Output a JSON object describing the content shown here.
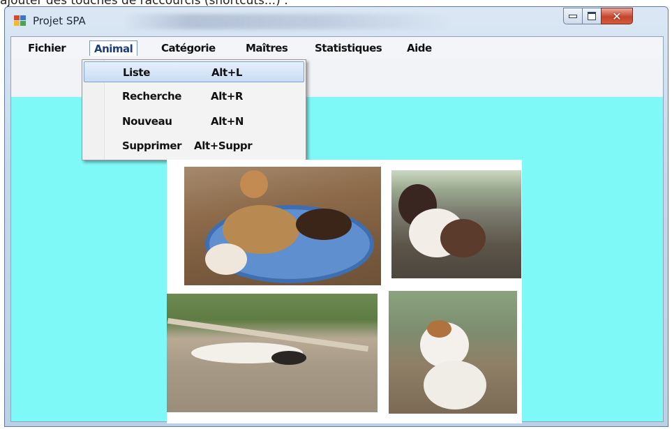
{
  "doc_text": "ajouter des touches de raccourcis (shortcuts...) :",
  "window": {
    "title": "Projet SPA",
    "controls": {
      "minimize": "minimize-icon",
      "maximize": "maximize-icon",
      "close": "close-icon"
    }
  },
  "menu": {
    "items": [
      {
        "label": "Fichier"
      },
      {
        "label": "Animal",
        "open": true
      },
      {
        "label": "Catégorie"
      },
      {
        "label": "Maîtres"
      },
      {
        "label": "Statistiques"
      },
      {
        "label": "Aide"
      }
    ]
  },
  "dropdown": {
    "items": [
      {
        "label": "Liste",
        "shortcut": "Alt+L",
        "highlighted": true
      },
      {
        "label": "Recherche",
        "shortcut": "Alt+R"
      },
      {
        "label": "Nouveau",
        "shortcut": "Alt+N"
      },
      {
        "label": "Supprimer",
        "shortcut": "Alt+Suppr"
      }
    ]
  },
  "colors": {
    "canvas": "#7ff9f7",
    "menu_highlight": "#c9dcf3",
    "close_button": "#c6452c"
  },
  "photos": [
    {
      "subject": "puppies-drinking-from-basin"
    },
    {
      "subject": "brown-white-dog-sitting"
    },
    {
      "subject": "cat-lying-on-patio"
    },
    {
      "subject": "small-terrier-sitting"
    }
  ]
}
